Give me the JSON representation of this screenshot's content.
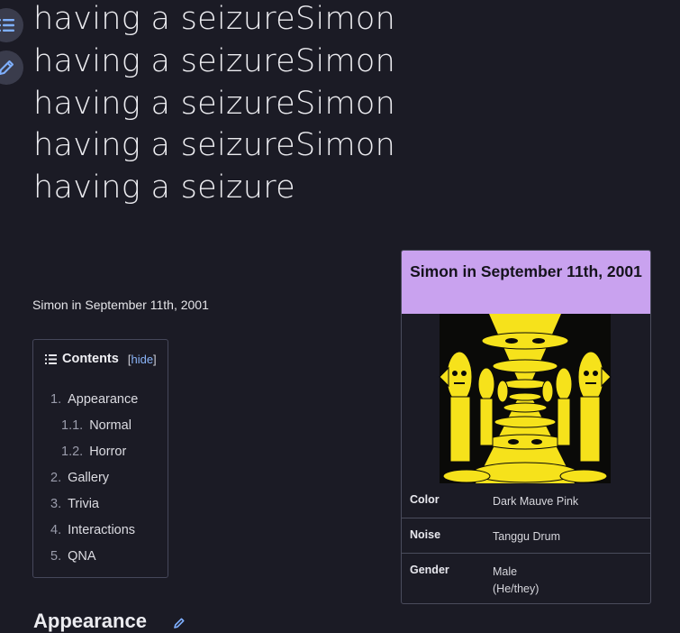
{
  "page": {
    "title_lines": [
      "having a seizureSimon",
      "having a seizureSimon",
      "having a seizureSimon",
      "having a seizureSimon",
      "having a seizure"
    ],
    "caption": "Simon in September 11th, 2001"
  },
  "floating_buttons": [
    {
      "name": "toc-toggle",
      "icon": "list-icon"
    },
    {
      "name": "edit",
      "icon": "pencil-icon"
    }
  ],
  "toc": {
    "title": "Contents",
    "hide_open": "[",
    "hide_label": "hide",
    "hide_close": "]",
    "items": [
      {
        "num": "1.",
        "label": "Appearance",
        "level": 1
      },
      {
        "num": "1.1.",
        "label": "Normal",
        "level": 2
      },
      {
        "num": "1.2.",
        "label": "Horror",
        "level": 2
      },
      {
        "num": "2.",
        "label": "Gallery",
        "level": 1
      },
      {
        "num": "3.",
        "label": "Trivia",
        "level": 1
      },
      {
        "num": "4.",
        "label": "Interactions",
        "level": 1
      },
      {
        "num": "5.",
        "label": "QNA",
        "level": 1
      }
    ]
  },
  "infobox": {
    "title": "Simon in September 11th, 2001",
    "rows": [
      {
        "key": "Color",
        "value": "Dark Mauve Pink"
      },
      {
        "key": "Noise",
        "value": "Tanggu Drum"
      },
      {
        "key": "Gender",
        "value": "Male",
        "value2": "(He/they)"
      }
    ],
    "header_color": "#c9a2ef"
  },
  "section": {
    "heading": "Appearance"
  },
  "colors": {
    "background": "#1b1b25",
    "link": "#8ab4f8",
    "image_yellow": "#f6e21b"
  }
}
